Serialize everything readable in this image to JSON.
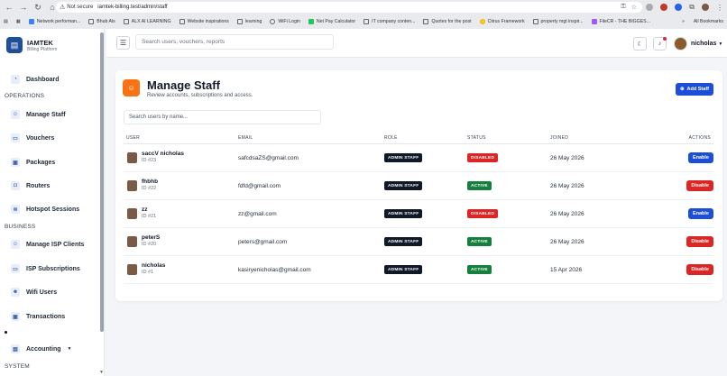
{
  "browser": {
    "not_secure": "Not secure",
    "url": "iamtek-billing.test/admin/staff",
    "bookmarks": [
      "Network performan...",
      "Bhub Als",
      "ALX AI LEARNING",
      "Website inspirations",
      "learning",
      "WiFi Login",
      "Net Pay Calculator",
      "IT company conten...",
      "Quotes for the post",
      "Citrus Framework",
      "property mgt inspir...",
      "FileCR - THE BIGGES..."
    ],
    "all_bookmarks": "All Bookmarks"
  },
  "brand": {
    "name": "IAMTEK",
    "sub": "Billing Platform"
  },
  "sidebar": {
    "dashboard": "Dashboard",
    "operations_heading": "OPERATIONS",
    "operations": [
      "Manage Staff",
      "Vouchers",
      "Packages",
      "Routers",
      "Hotspot Sessions"
    ],
    "business_heading": "BUSINESS",
    "business": [
      "Manage ISP Clients",
      "ISP Subscriptions",
      "Wifi Users",
      "Transactions"
    ],
    "accounting": "Accounting",
    "system_heading": "SYSTEM"
  },
  "topbar": {
    "search_placeholder": "Search users, vouchers, reports",
    "user_name": "nicholas"
  },
  "page": {
    "title": "Manage Staff",
    "subtitle": "Review accounts, subscriptions and access.",
    "add_button": "Add Staff",
    "search_placeholder": "Search users by name..."
  },
  "table": {
    "headers": {
      "user": "USER",
      "email": "EMAIL",
      "role": "ROLE",
      "status": "STATUS",
      "joined": "JOINED",
      "actions": "ACTIONS"
    },
    "rows": [
      {
        "name": "saccV nicholas",
        "id": "ID #23",
        "email": "safcdsaZS@gmail.com",
        "role": "ADMIN STAFF",
        "status": "DISABLED",
        "joined": "26 May 2026",
        "action": "Enable"
      },
      {
        "name": "fhbhb",
        "id": "ID #22",
        "email": "fdfd@gmail.com",
        "role": "ADMIN STAFF",
        "status": "ACTIVE",
        "joined": "26 May 2026",
        "action": "Disable"
      },
      {
        "name": "zz",
        "id": "ID #21",
        "email": "zz@gmail.com",
        "role": "ADMIN STAFF",
        "status": "DISABLED",
        "joined": "26 May 2026",
        "action": "Enable"
      },
      {
        "name": "peterS",
        "id": "ID #20",
        "email": "peters@gmail.com",
        "role": "ADMIN STAFF",
        "status": "ACTIVE",
        "joined": "26 May 2026",
        "action": "Disable"
      },
      {
        "name": "nicholas",
        "id": "ID #1",
        "email": "kasiryenicholas@gmail.com",
        "role": "ADMIN STAFF",
        "status": "ACTIVE",
        "joined": "15 Apr 2026",
        "action": "Disable"
      }
    ]
  },
  "colors": {
    "active": "#15803d",
    "disabled": "#dc2626",
    "enable_btn": "#1d4ed8",
    "disable_btn": "#dc2626",
    "accent": "#f97316"
  }
}
